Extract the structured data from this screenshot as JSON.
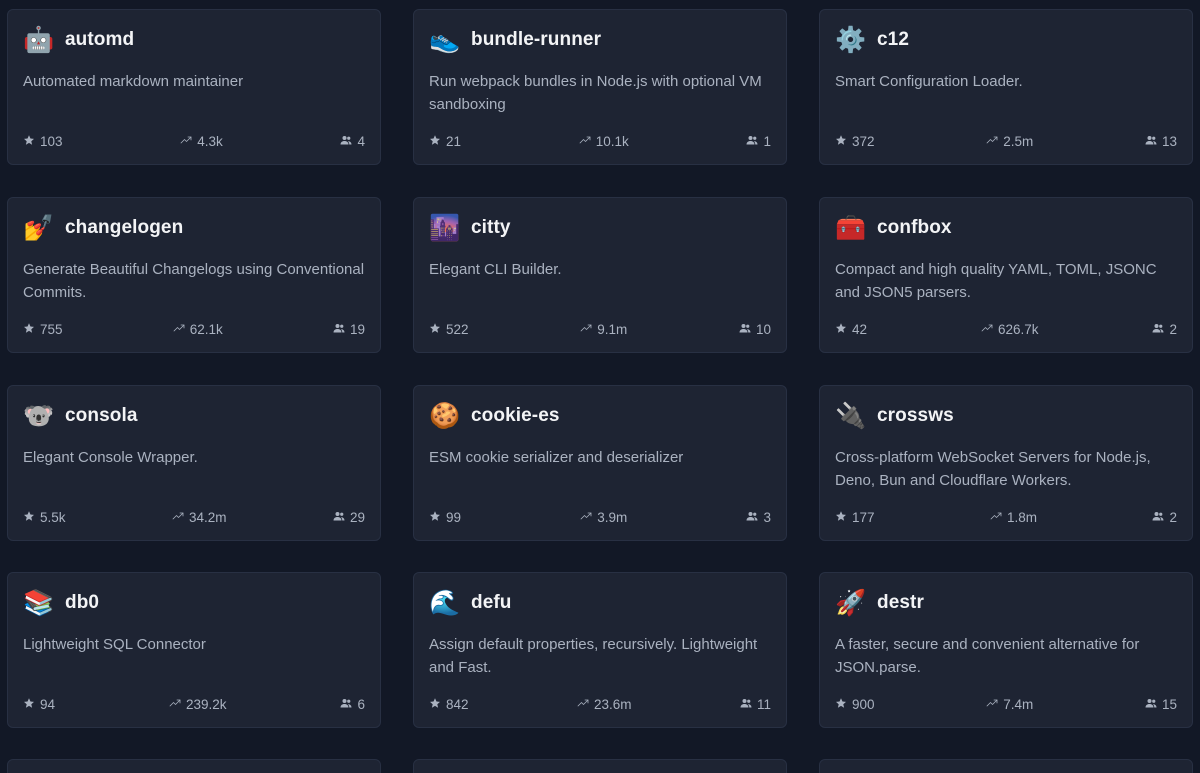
{
  "cards": [
    {
      "name": "automd",
      "icon": "robot-emoji",
      "emoji": "🤖",
      "description": "Automated markdown maintainer",
      "stars": "103",
      "downloads": "4.3k",
      "contributors": "4"
    },
    {
      "name": "bundle-runner",
      "icon": "running-shoe-emoji",
      "emoji": "👟",
      "description": "Run webpack bundles in Node.js with optional VM sandboxing",
      "stars": "21",
      "downloads": "10.1k",
      "contributors": "1"
    },
    {
      "name": "c12",
      "icon": "gear-emoji",
      "emoji": "⚙️",
      "description": "Smart Configuration Loader.",
      "stars": "372",
      "downloads": "2.5m",
      "contributors": "13"
    },
    {
      "name": "changelogen",
      "icon": "nail-polish-emoji",
      "emoji": "💅",
      "description": "Generate Beautiful Changelogs using Conventional Commits.",
      "stars": "755",
      "downloads": "62.1k",
      "contributors": "19"
    },
    {
      "name": "citty",
      "icon": "night-city-emoji",
      "emoji": "🌆",
      "description": "Elegant CLI Builder.",
      "stars": "522",
      "downloads": "9.1m",
      "contributors": "10"
    },
    {
      "name": "confbox",
      "icon": "toolbox-emoji",
      "emoji": "🧰",
      "description": "Compact and high quality YAML, TOML, JSONC and JSON5 parsers.",
      "stars": "42",
      "downloads": "626.7k",
      "contributors": "2"
    },
    {
      "name": "consola",
      "icon": "koala-emoji",
      "emoji": "🐨",
      "description": "Elegant Console Wrapper.",
      "stars": "5.5k",
      "downloads": "34.2m",
      "contributors": "29"
    },
    {
      "name": "cookie-es",
      "icon": "cookie-emoji",
      "emoji": "🍪",
      "description": "ESM cookie serializer and deserializer",
      "stars": "99",
      "downloads": "3.9m",
      "contributors": "3"
    },
    {
      "name": "crossws",
      "icon": "electric-plug-emoji",
      "emoji": "🔌",
      "description": "Cross-platform WebSocket Servers for Node.js, Deno, Bun and Cloudflare Workers.",
      "stars": "177",
      "downloads": "1.8m",
      "contributors": "2"
    },
    {
      "name": "db0",
      "icon": "books-emoji",
      "emoji": "📚",
      "description": "Lightweight SQL Connector",
      "stars": "94",
      "downloads": "239.2k",
      "contributors": "6"
    },
    {
      "name": "defu",
      "icon": "water-wave-emoji",
      "emoji": "🌊",
      "description": "Assign default properties, recursively. Lightweight and Fast.",
      "stars": "842",
      "downloads": "23.6m",
      "contributors": "11"
    },
    {
      "name": "destr",
      "icon": "rocket-emoji",
      "emoji": "🚀",
      "description": "A faster, secure and convenient alternative for JSON.parse.",
      "stars": "900",
      "downloads": "7.4m",
      "contributors": "15"
    }
  ],
  "stat_icons": {
    "stars": "star-icon",
    "downloads": "trending-up-icon",
    "contributors": "users-icon"
  }
}
